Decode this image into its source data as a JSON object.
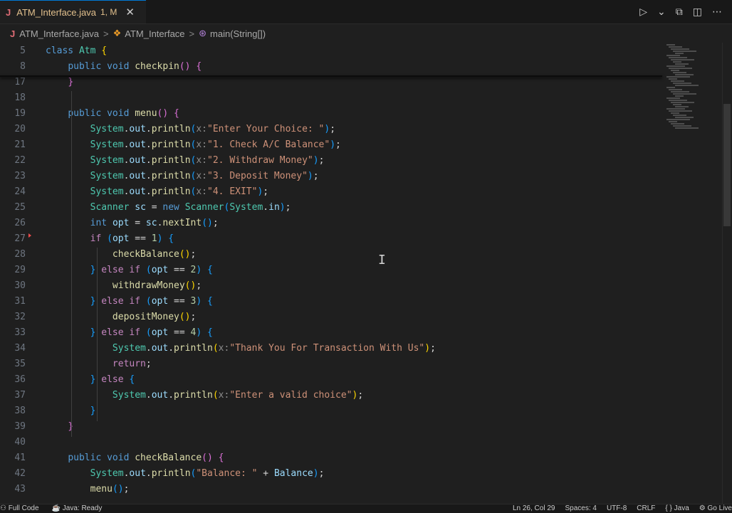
{
  "tab": {
    "filename": "ATM_Interface.java",
    "badge": "1, M",
    "close_glyph": "✕",
    "lang_glyph": "J"
  },
  "actions": {
    "run": "▷",
    "run_dropdown": "⌄",
    "compare": "⧉",
    "split": "◫",
    "more": "⋯"
  },
  "breadcrumb": {
    "file": "ATM_Interface.java",
    "class": "ATM_Interface",
    "method": "main(String[])",
    "sep": ">"
  },
  "code_lines": [
    {
      "n": "5",
      "tokens": [
        [
          "kw",
          "class "
        ],
        [
          "ty",
          "Atm "
        ],
        [
          "br1",
          "{"
        ]
      ]
    },
    {
      "n": "8",
      "tokens": [
        [
          "pl",
          "    "
        ],
        [
          "kw",
          "public void "
        ],
        [
          "fn",
          "checkpin"
        ],
        [
          "br2",
          "() "
        ],
        [
          "br2",
          "{"
        ]
      ]
    },
    {
      "n": "17",
      "tokens": [
        [
          "pl",
          "    "
        ],
        [
          "br2",
          "}"
        ]
      ]
    },
    {
      "n": "18",
      "tokens": []
    },
    {
      "n": "19",
      "tokens": [
        [
          "pl",
          "    "
        ],
        [
          "kw",
          "public void "
        ],
        [
          "fn",
          "menu"
        ],
        [
          "br2",
          "() {"
        ]
      ]
    },
    {
      "n": "20",
      "tokens": [
        [
          "pl",
          "        "
        ],
        [
          "ty",
          "System"
        ],
        [
          "pl",
          "."
        ],
        [
          "var",
          "out"
        ],
        [
          "pl",
          "."
        ],
        [
          "fn",
          "println"
        ],
        [
          "br3",
          "("
        ],
        [
          "hint",
          "x:"
        ],
        [
          "str",
          "\"Enter Your Choice: \""
        ],
        [
          "br3",
          ")"
        ],
        [
          "pl",
          ";"
        ]
      ]
    },
    {
      "n": "21",
      "tokens": [
        [
          "pl",
          "        "
        ],
        [
          "ty",
          "System"
        ],
        [
          "pl",
          "."
        ],
        [
          "var",
          "out"
        ],
        [
          "pl",
          "."
        ],
        [
          "fn",
          "println"
        ],
        [
          "br3",
          "("
        ],
        [
          "hint",
          "x:"
        ],
        [
          "str",
          "\"1. Check A/C Balance\""
        ],
        [
          "br3",
          ")"
        ],
        [
          "pl",
          ";"
        ]
      ]
    },
    {
      "n": "22",
      "tokens": [
        [
          "pl",
          "        "
        ],
        [
          "ty",
          "System"
        ],
        [
          "pl",
          "."
        ],
        [
          "var",
          "out"
        ],
        [
          "pl",
          "."
        ],
        [
          "fn",
          "println"
        ],
        [
          "br3",
          "("
        ],
        [
          "hint",
          "x:"
        ],
        [
          "str",
          "\"2. Withdraw Money\""
        ],
        [
          "br3",
          ")"
        ],
        [
          "pl",
          ";"
        ]
      ]
    },
    {
      "n": "23",
      "tokens": [
        [
          "pl",
          "        "
        ],
        [
          "ty",
          "System"
        ],
        [
          "pl",
          "."
        ],
        [
          "var",
          "out"
        ],
        [
          "pl",
          "."
        ],
        [
          "fn",
          "println"
        ],
        [
          "br3",
          "("
        ],
        [
          "hint",
          "x:"
        ],
        [
          "str",
          "\"3. Deposit Money\""
        ],
        [
          "br3",
          ")"
        ],
        [
          "pl",
          ";"
        ]
      ]
    },
    {
      "n": "24",
      "tokens": [
        [
          "pl",
          "        "
        ],
        [
          "ty",
          "System"
        ],
        [
          "pl",
          "."
        ],
        [
          "var",
          "out"
        ],
        [
          "pl",
          "."
        ],
        [
          "fn",
          "println"
        ],
        [
          "br3",
          "("
        ],
        [
          "hint",
          "x:"
        ],
        [
          "str",
          "\"4. EXIT\""
        ],
        [
          "br3",
          ")"
        ],
        [
          "pl",
          ";"
        ]
      ]
    },
    {
      "n": "25",
      "tokens": [
        [
          "pl",
          "        "
        ],
        [
          "ty",
          "Scanner "
        ],
        [
          "var",
          "sc"
        ],
        [
          "pl",
          " = "
        ],
        [
          "kw",
          "new "
        ],
        [
          "ty",
          "Scanner"
        ],
        [
          "br3",
          "("
        ],
        [
          "ty",
          "System"
        ],
        [
          "pl",
          "."
        ],
        [
          "var",
          "in"
        ],
        [
          "br3",
          ")"
        ],
        [
          "pl",
          ";"
        ]
      ]
    },
    {
      "n": "26",
      "tokens": [
        [
          "pl",
          "        "
        ],
        [
          "kw",
          "int "
        ],
        [
          "var",
          "opt"
        ],
        [
          "pl",
          " = "
        ],
        [
          "var",
          "sc"
        ],
        [
          "pl",
          "."
        ],
        [
          "fn",
          "nextInt"
        ],
        [
          "br3",
          "()"
        ],
        [
          "pl",
          ";"
        ]
      ]
    },
    {
      "n": "27",
      "tokens": [
        [
          "pl",
          "        "
        ],
        [
          "ctl",
          "if "
        ],
        [
          "br3",
          "("
        ],
        [
          "var",
          "opt"
        ],
        [
          "pl",
          " == "
        ],
        [
          "num",
          "1"
        ],
        [
          "br3",
          ") {"
        ]
      ]
    },
    {
      "n": "28",
      "tokens": [
        [
          "pl",
          "            "
        ],
        [
          "fn",
          "checkBalance"
        ],
        [
          "br1",
          "()"
        ],
        [
          "pl",
          ";"
        ]
      ]
    },
    {
      "n": "29",
      "tokens": [
        [
          "pl",
          "        "
        ],
        [
          "br3",
          "} "
        ],
        [
          "ctl",
          "else if "
        ],
        [
          "br3",
          "("
        ],
        [
          "var",
          "opt"
        ],
        [
          "pl",
          " == "
        ],
        [
          "num",
          "2"
        ],
        [
          "br3",
          ") {"
        ]
      ]
    },
    {
      "n": "30",
      "tokens": [
        [
          "pl",
          "            "
        ],
        [
          "fn",
          "withdrawMoney"
        ],
        [
          "br1",
          "()"
        ],
        [
          "pl",
          ";"
        ]
      ]
    },
    {
      "n": "31",
      "tokens": [
        [
          "pl",
          "        "
        ],
        [
          "br3",
          "} "
        ],
        [
          "ctl",
          "else if "
        ],
        [
          "br3",
          "("
        ],
        [
          "var",
          "opt"
        ],
        [
          "pl",
          " == "
        ],
        [
          "num",
          "3"
        ],
        [
          "br3",
          ") {"
        ]
      ]
    },
    {
      "n": "32",
      "tokens": [
        [
          "pl",
          "            "
        ],
        [
          "fn",
          "depositMoney"
        ],
        [
          "br1",
          "()"
        ],
        [
          "pl",
          ";"
        ]
      ]
    },
    {
      "n": "33",
      "tokens": [
        [
          "pl",
          "        "
        ],
        [
          "br3",
          "} "
        ],
        [
          "ctl",
          "else if "
        ],
        [
          "br3",
          "("
        ],
        [
          "var",
          "opt"
        ],
        [
          "pl",
          " == "
        ],
        [
          "num",
          "4"
        ],
        [
          "br3",
          ") {"
        ]
      ]
    },
    {
      "n": "34",
      "tokens": [
        [
          "pl",
          "            "
        ],
        [
          "ty",
          "System"
        ],
        [
          "pl",
          "."
        ],
        [
          "var",
          "out"
        ],
        [
          "pl",
          "."
        ],
        [
          "fn",
          "println"
        ],
        [
          "br1",
          "("
        ],
        [
          "hint",
          "x:"
        ],
        [
          "str",
          "\"Thank You For Transaction With Us\""
        ],
        [
          "br1",
          ")"
        ],
        [
          "pl",
          ";"
        ]
      ]
    },
    {
      "n": "35",
      "tokens": [
        [
          "pl",
          "            "
        ],
        [
          "ctl",
          "return"
        ],
        [
          "pl",
          ";"
        ]
      ]
    },
    {
      "n": "36",
      "tokens": [
        [
          "pl",
          "        "
        ],
        [
          "br3",
          "} "
        ],
        [
          "ctl",
          "else "
        ],
        [
          "br3",
          "{"
        ]
      ]
    },
    {
      "n": "37",
      "tokens": [
        [
          "pl",
          "            "
        ],
        [
          "ty",
          "System"
        ],
        [
          "pl",
          "."
        ],
        [
          "var",
          "out"
        ],
        [
          "pl",
          "."
        ],
        [
          "fn",
          "println"
        ],
        [
          "br1",
          "("
        ],
        [
          "hint",
          "x:"
        ],
        [
          "str",
          "\"Enter a valid choice\""
        ],
        [
          "br1",
          ")"
        ],
        [
          "pl",
          ";"
        ]
      ]
    },
    {
      "n": "38",
      "tokens": [
        [
          "pl",
          "        "
        ],
        [
          "br3",
          "}"
        ]
      ]
    },
    {
      "n": "39",
      "tokens": [
        [
          "pl",
          "    "
        ],
        [
          "br2",
          "}"
        ]
      ]
    },
    {
      "n": "40",
      "tokens": []
    },
    {
      "n": "41",
      "tokens": [
        [
          "pl",
          "    "
        ],
        [
          "kw",
          "public void "
        ],
        [
          "fn",
          "checkBalance"
        ],
        [
          "br2",
          "() {"
        ]
      ]
    },
    {
      "n": "42",
      "tokens": [
        [
          "pl",
          "        "
        ],
        [
          "ty",
          "System"
        ],
        [
          "pl",
          "."
        ],
        [
          "var",
          "out"
        ],
        [
          "pl",
          "."
        ],
        [
          "fn",
          "println"
        ],
        [
          "br3",
          "("
        ],
        [
          "str",
          "\"Balance: \""
        ],
        [
          "pl",
          " + "
        ],
        [
          "var",
          "Balance"
        ],
        [
          "br3",
          ")"
        ],
        [
          "pl",
          ";"
        ]
      ]
    },
    {
      "n": "43",
      "tokens": [
        [
          "pl",
          "        "
        ],
        [
          "fn",
          "menu"
        ],
        [
          "br3",
          "()"
        ],
        [
          "pl",
          ";"
        ]
      ]
    }
  ],
  "statusbar": {
    "remote": "",
    "left": [
      "⚇ Full Code",
      "☕ Java: Ready"
    ],
    "right": [
      "Ln 26, Col 29",
      "Spaces: 4",
      "UTF-8",
      "CRLF",
      "{ } Java",
      "⚙ Go Live"
    ]
  },
  "colors": {
    "background": "#1f1f1f",
    "accent": "#0078d4",
    "keyword": "#569cd6",
    "string": "#ce9178",
    "function": "#dcdcaa",
    "type": "#4ec9b0"
  },
  "icons": [
    "java-file-icon",
    "close-icon",
    "run-icon",
    "split-editor-icon",
    "compare-icon",
    "class-icon",
    "method-icon",
    "text-cursor-icon"
  ]
}
